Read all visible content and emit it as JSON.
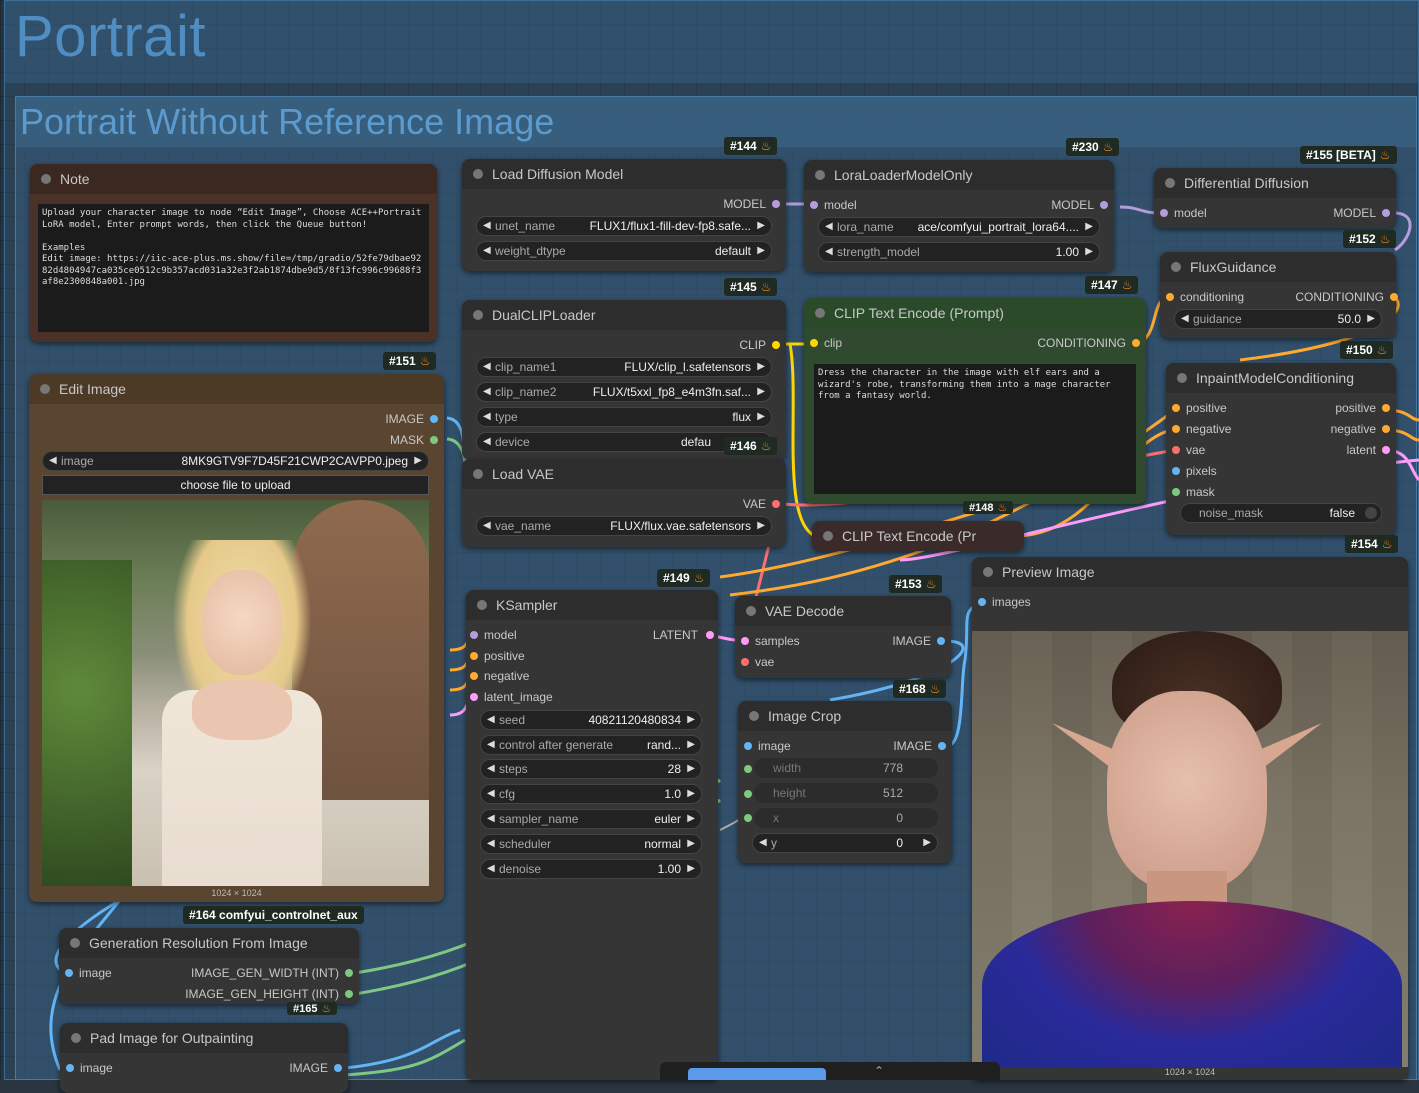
{
  "groups": {
    "outer_title": "Portrait",
    "inner_title": "Portrait Without Reference Image"
  },
  "note": {
    "title": "Note",
    "text": "Upload your character image to node “Edit Image”, Choose ACE++Portrait LoRA model, Enter prompt words, then click the Queue button!\n\nExamples\nEdit image: https://iic-ace-plus.ms.show/file=/tmp/gradio/52fe79dbae9282d4804947ca035ce0512c9b357acd031a32e3f2ab1874dbe9d5/8f13fc996c99688f3af8e2300848a001.jpg"
  },
  "edit_image": {
    "badge": "#151",
    "title": "Edit Image",
    "out1": "IMAGE",
    "out2": "MASK",
    "image_label": "image",
    "image_value": "8MK9GTV9F7D45F21CWP2CAVPP0.jpeg",
    "upload_button": "choose file to upload",
    "size": "1024 × 1024"
  },
  "load_diffusion": {
    "badge": "#144",
    "title": "Load Diffusion Model",
    "out": "MODEL",
    "w1_label": "unet_name",
    "w1_value": "FLUX1/flux1-fill-dev-fp8.safe...",
    "w2_label": "weight_dtype",
    "w2_value": "default"
  },
  "lora": {
    "badge": "#230",
    "title": "LoraLoaderModelOnly",
    "in": "model",
    "out": "MODEL",
    "w1_label": "lora_name",
    "w1_value": "ace/comfyui_portrait_lora64....",
    "w2_label": "strength_model",
    "w2_value": "1.00"
  },
  "diff": {
    "badge": "#155 [BETA]",
    "title": "Differential Diffusion",
    "in": "model",
    "out": "MODEL"
  },
  "flux_guidance": {
    "badge": "#152",
    "title": "FluxGuidance",
    "in": "conditioning",
    "out": "CONDITIONING",
    "w_label": "guidance",
    "w_value": "50.0"
  },
  "dual_clip": {
    "badge": "#145",
    "title": "DualCLIPLoader",
    "out": "CLIP",
    "w1_label": "clip_name1",
    "w1_value": "FLUX/clip_l.safetensors",
    "w2_label": "clip_name2",
    "w2_value": "FLUX/t5xxl_fp8_e4m3fn.saf...",
    "w3_label": "type",
    "w3_value": "flux",
    "w4_label": "device",
    "w4_value": "defau"
  },
  "clip_text": {
    "badge": "#147",
    "title": "CLIP Text Encode (Prompt)",
    "in": "clip",
    "out": "CONDITIONING",
    "text": "Dress the character in the image with elf ears and a wizard's robe, transforming them into a mage character from a fantasy world."
  },
  "clip_text2": {
    "badge": "#148",
    "title": "CLIP Text Encode (Pr"
  },
  "load_vae": {
    "badge": "#146",
    "title": "Load VAE",
    "out": "VAE",
    "w_label": "vae_name",
    "w_value": "FLUX/flux.vae.safetensors"
  },
  "inpaint": {
    "badge": "#150",
    "title": "InpaintModelConditioning",
    "in1": "positive",
    "in2": "negative",
    "in3": "vae",
    "in4": "pixels",
    "in5": "mask",
    "out1": "positive",
    "out2": "negative",
    "out3": "latent",
    "toggle_label": "noise_mask",
    "toggle_value": "false"
  },
  "ksampler": {
    "badge": "#149",
    "title": "KSampler",
    "in1": "model",
    "in2": "positive",
    "in3": "negative",
    "in4": "latent_image",
    "out": "LATENT",
    "widgets": [
      {
        "label": "seed",
        "value": "40821120480834"
      },
      {
        "label": "control after generate",
        "value": "rand..."
      },
      {
        "label": "steps",
        "value": "28"
      },
      {
        "label": "cfg",
        "value": "1.0"
      },
      {
        "label": "sampler_name",
        "value": "euler"
      },
      {
        "label": "scheduler",
        "value": "normal"
      },
      {
        "label": "denoise",
        "value": "1.00"
      }
    ]
  },
  "vae_decode": {
    "badge": "#153",
    "title": "VAE Decode",
    "in1": "samples",
    "in2": "vae",
    "out": "IMAGE"
  },
  "image_crop": {
    "badge": "#168",
    "title": "Image Crop",
    "in": "image",
    "out": "IMAGE",
    "widgets": [
      {
        "label": "width",
        "value": "778"
      },
      {
        "label": "height",
        "value": "512"
      },
      {
        "label": "x",
        "value": "0"
      },
      {
        "label": "y",
        "value": "0"
      }
    ]
  },
  "preview": {
    "badge": "#154",
    "title": "Preview Image",
    "in": "images",
    "size": "1024 × 1024"
  },
  "gen_res": {
    "badge": "#164 comfyui_controlnet_aux",
    "title": "Generation Resolution From Image",
    "in": "image",
    "out1": "IMAGE_GEN_WIDTH (INT)",
    "out2": "IMAGE_GEN_HEIGHT (INT)"
  },
  "pad": {
    "badge": "#165",
    "title": "Pad Image for Outpainting",
    "in": "image",
    "out": "IMAGE"
  },
  "colors": {
    "model": "#b39ddb",
    "clip": "#ffd500",
    "conditioning": "#ffa931",
    "vae": "#ff6e6e",
    "latent": "#ff9cf9",
    "image": "#64b5f6",
    "mask": "#81c784"
  }
}
